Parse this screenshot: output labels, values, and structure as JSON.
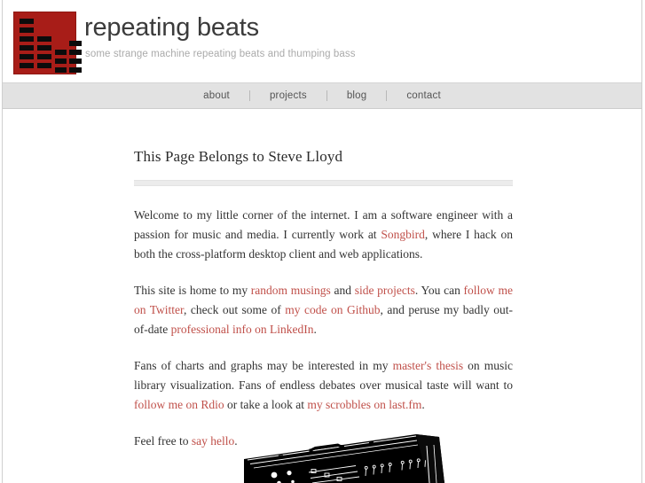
{
  "site": {
    "title": "repeating beats",
    "tagline": "some strange machine repeating beats and thumping bass",
    "logo_icon": "equalizer-bars-icon",
    "logo_color": "#a81d18",
    "accent_link_color": "#c0504a"
  },
  "nav": {
    "items": [
      {
        "label": "about"
      },
      {
        "label": "projects"
      },
      {
        "label": "blog"
      },
      {
        "label": "contact"
      }
    ],
    "separator": "|"
  },
  "main": {
    "heading": "This Page Belongs to Steve Lloyd",
    "paragraphs": [
      {
        "parts": [
          {
            "type": "text",
            "text": "Welcome to my little corner of the internet. I am a software engineer with a passion for music and media. I currently work at "
          },
          {
            "type": "link",
            "text": "Songbird"
          },
          {
            "type": "text",
            "text": ", where I hack on both the cross-platform desktop client and web applications."
          }
        ]
      },
      {
        "parts": [
          {
            "type": "text",
            "text": "This site is home to my "
          },
          {
            "type": "link",
            "text": "random musings"
          },
          {
            "type": "text",
            "text": " and "
          },
          {
            "type": "link",
            "text": "side projects"
          },
          {
            "type": "text",
            "text": ". You can "
          },
          {
            "type": "link",
            "text": "follow me on Twitter"
          },
          {
            "type": "text",
            "text": ", check out some of "
          },
          {
            "type": "link",
            "text": "my code on Github"
          },
          {
            "type": "text",
            "text": ", and peruse my badly out-of-date "
          },
          {
            "type": "link",
            "text": "professional info on LinkedIn"
          },
          {
            "type": "text",
            "text": "."
          }
        ]
      },
      {
        "parts": [
          {
            "type": "text",
            "text": "Fans of charts and graphs may be interested in my "
          },
          {
            "type": "link",
            "text": "master's thesis"
          },
          {
            "type": "text",
            "text": " on music library visualization. Fans of endless debates over musical taste will want to "
          },
          {
            "type": "link",
            "text": "follow me on Rdio"
          },
          {
            "type": "text",
            "text": " or take a look at "
          },
          {
            "type": "link",
            "text": "my scrobbles on last.fm"
          },
          {
            "type": "text",
            "text": "."
          }
        ]
      },
      {
        "parts": [
          {
            "type": "text",
            "text": "Feel free to "
          },
          {
            "type": "link",
            "text": "say hello"
          },
          {
            "type": "text",
            "text": "."
          }
        ]
      }
    ]
  },
  "footer": {
    "illustration": "drum-machine-silhouette-illustration"
  }
}
